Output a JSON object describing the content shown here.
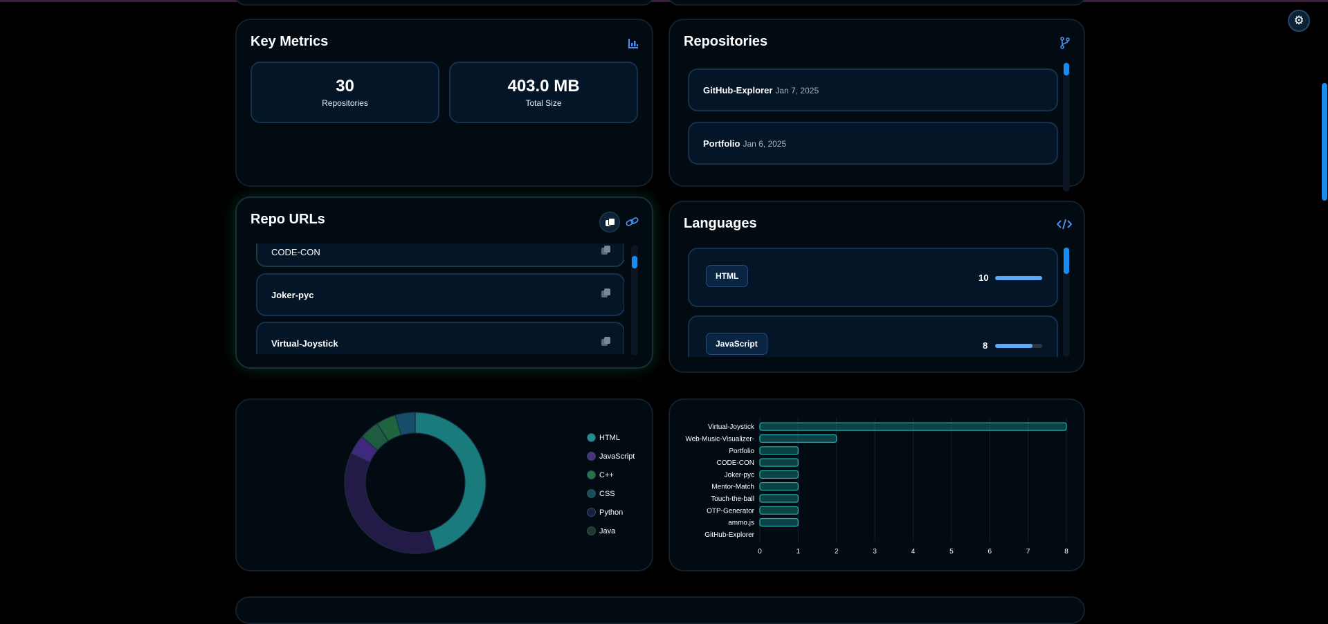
{
  "metrics": {
    "title": "Key Metrics",
    "header_icon": "bar-chart-icon",
    "repositories_value": "30",
    "repositories_label": "Repositories",
    "size_value": "403.0 MB",
    "size_label": "Total Size"
  },
  "repositories": {
    "title": "Repositories",
    "header_icon": "git-branch-icon",
    "items": [
      {
        "name": "GitHub-Explorer",
        "date": "Jan 7, 2025"
      },
      {
        "name": "Portfolio",
        "date": "Jan 6, 2025"
      }
    ]
  },
  "repo_urls": {
    "title": "Repo URLs",
    "copy_all_icon": "copy-icon",
    "link_icon": "link-icon",
    "items": [
      {
        "name": "CODE-CON"
      },
      {
        "name": "Joker-pyc"
      },
      {
        "name": "Virtual-Joystick"
      }
    ]
  },
  "languages": {
    "title": "Languages",
    "header_icon": "code-icon",
    "items": [
      {
        "name": "HTML",
        "count": "10",
        "fill_fraction": 1.0
      },
      {
        "name": "JavaScript",
        "count": "8",
        "fill_fraction": 0.8
      }
    ]
  },
  "donut": {
    "legend": [
      {
        "name": "HTML",
        "color": "#1f8f8f"
      },
      {
        "name": "JavaScript",
        "color": "#4b2f80"
      },
      {
        "name": "C++",
        "color": "#237447"
      },
      {
        "name": "CSS",
        "color": "#184f58"
      },
      {
        "name": "Python",
        "color": "#1d1f42"
      },
      {
        "name": "Java",
        "color": "#1b3b2b"
      }
    ]
  },
  "chart_data": [
    {
      "type": "pie",
      "variant": "donut",
      "labels": [
        "HTML",
        "JavaScript",
        "C++",
        "CSS",
        "Python",
        "Java"
      ],
      "values": [
        10,
        8,
        1,
        1,
        0,
        0
      ],
      "extra_slices": [
        {
          "value": 1,
          "color": "#4a2f8f"
        },
        {
          "value": 1,
          "color": "#256a4a"
        }
      ],
      "colors": [
        "#1f8f8f",
        "#2a1d52",
        "#237447",
        "#1a5a7a",
        "#1d1f42",
        "#1b3b2b"
      ],
      "legend_position": "right"
    },
    {
      "type": "bar",
      "orientation": "horizontal",
      "categories": [
        "Virtual-Joystick",
        "Web-Music-Visualizer-",
        "Portfolio",
        "CODE-CON",
        "Joker-pyc",
        "Mentor-Match",
        "Touch-the-ball",
        "OTP-Generator",
        "ammo.js",
        "GitHub-Explorer"
      ],
      "values": [
        8,
        2,
        1,
        1,
        1,
        1,
        1,
        1,
        1,
        0
      ],
      "xlim": [
        0,
        8
      ],
      "xticks": [
        "0",
        "1",
        "2",
        "3",
        "4",
        "5",
        "6",
        "7",
        "8"
      ],
      "grid": true,
      "color": "#1fa8a8"
    }
  ],
  "ui": {
    "theme_icon": "gear-icon"
  }
}
